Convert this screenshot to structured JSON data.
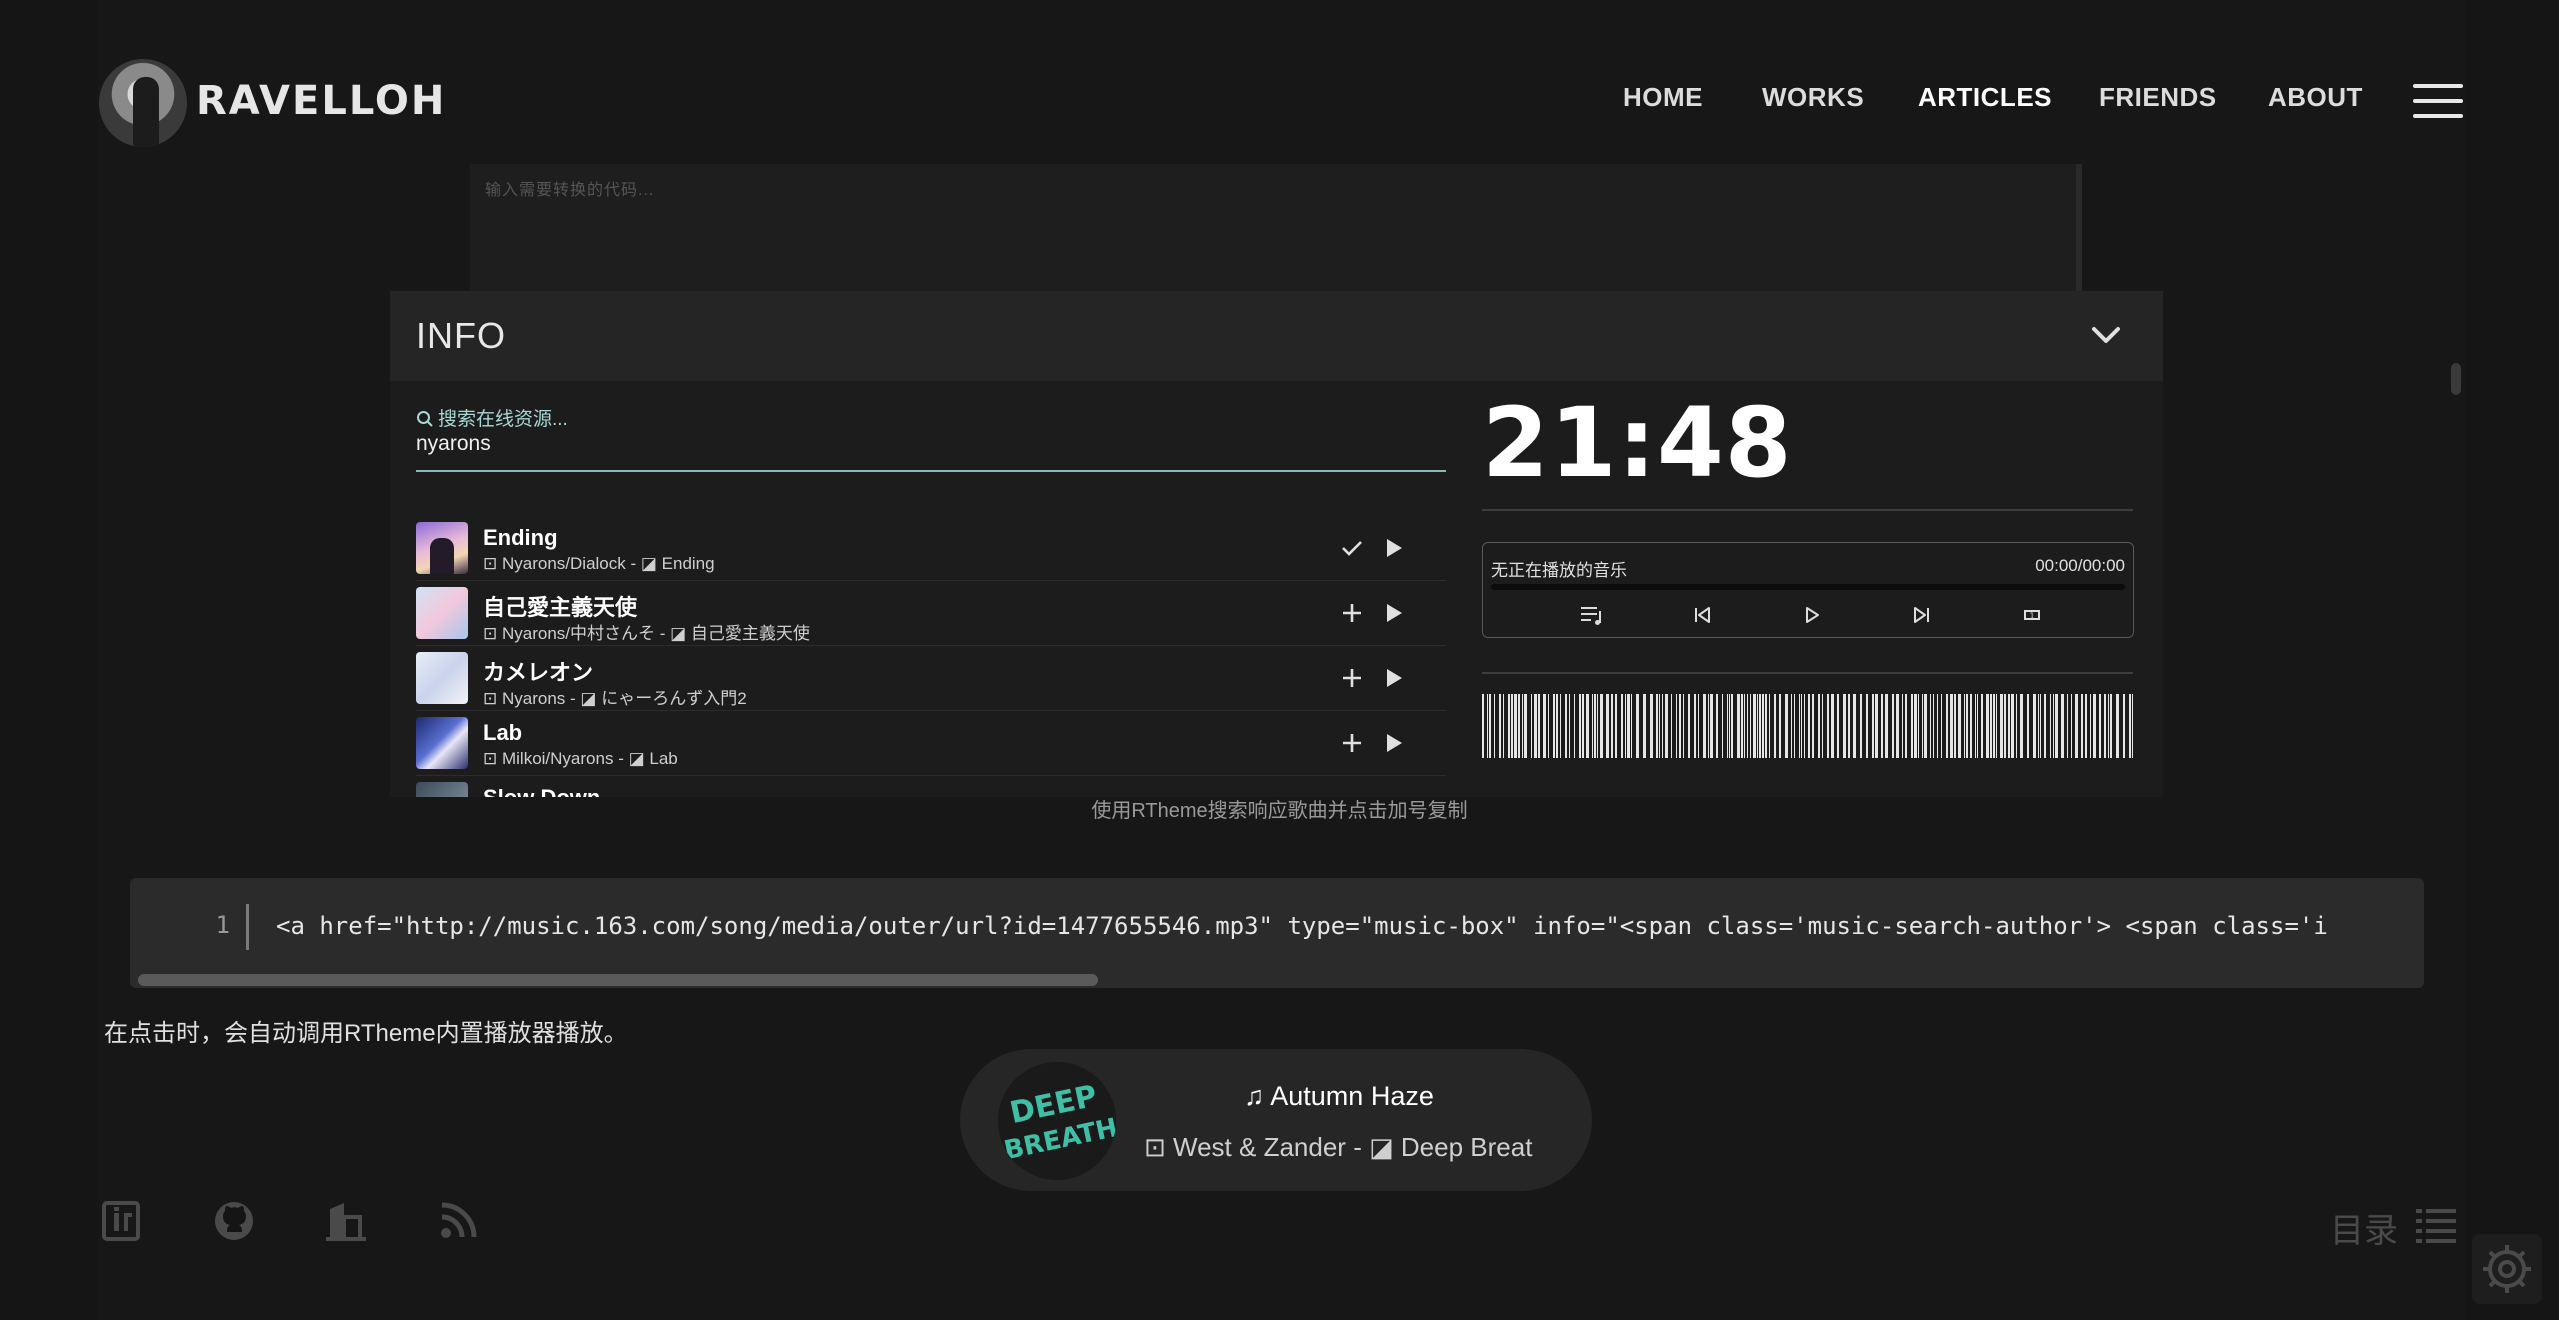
{
  "header": {
    "logo_text": "RAVELLOH",
    "nav": [
      "HOME",
      "WORKS",
      "ARTICLES",
      "FRIENDS",
      "ABOUT"
    ],
    "active_nav": "ARTICLES"
  },
  "code_input": {
    "placeholder": "输入需要转换的代码..."
  },
  "info_panel": {
    "title": "INFO",
    "search": {
      "placeholder": "搜索在线资源...",
      "value": "nyarons"
    },
    "results": [
      {
        "title": "Ending",
        "artist": "Nyarons/Dialock",
        "album": "Ending",
        "action": "check-icon"
      },
      {
        "title": "自己愛主義天使",
        "artist": "Nyarons/中村さんそ",
        "album": "自己愛主義天使",
        "action": "plus-icon"
      },
      {
        "title": "カメレオン",
        "artist": "Nyarons",
        "album": "にゃーろんず入門2",
        "action": "plus-icon"
      },
      {
        "title": "Lab",
        "artist": "Milkoi/Nyarons",
        "album": "Lab",
        "action": "plus-icon"
      },
      {
        "title": "Slow Down",
        "artist": "",
        "album": "",
        "action": "plus-icon"
      }
    ],
    "clock": "21:48",
    "player": {
      "status": "无正在播放的音乐",
      "time": "00:00/00:00"
    }
  },
  "caption": "使用RTheme搜索响应歌曲并点击加号复制",
  "code_block": {
    "line_number": "1",
    "code": "<a href=\"http://music.163.com/song/media/outer/url?id=1477655546.mp3\" type=\"music-box\" info=\"<span class='music-search-author'> <span class='i"
  },
  "note": "在点击时，会自动调用RTheme内置播放器播放。",
  "now_playing": {
    "title": "Autumn Haze",
    "artist": "West & Zander",
    "album": "Deep Breat",
    "disc_text": "DEEP BREATHING"
  },
  "footer": {
    "toc_label": "目录"
  },
  "colors": {
    "background": "#151515",
    "accent_teal": "#8ab8b6",
    "panel": "#1c1c1c"
  }
}
